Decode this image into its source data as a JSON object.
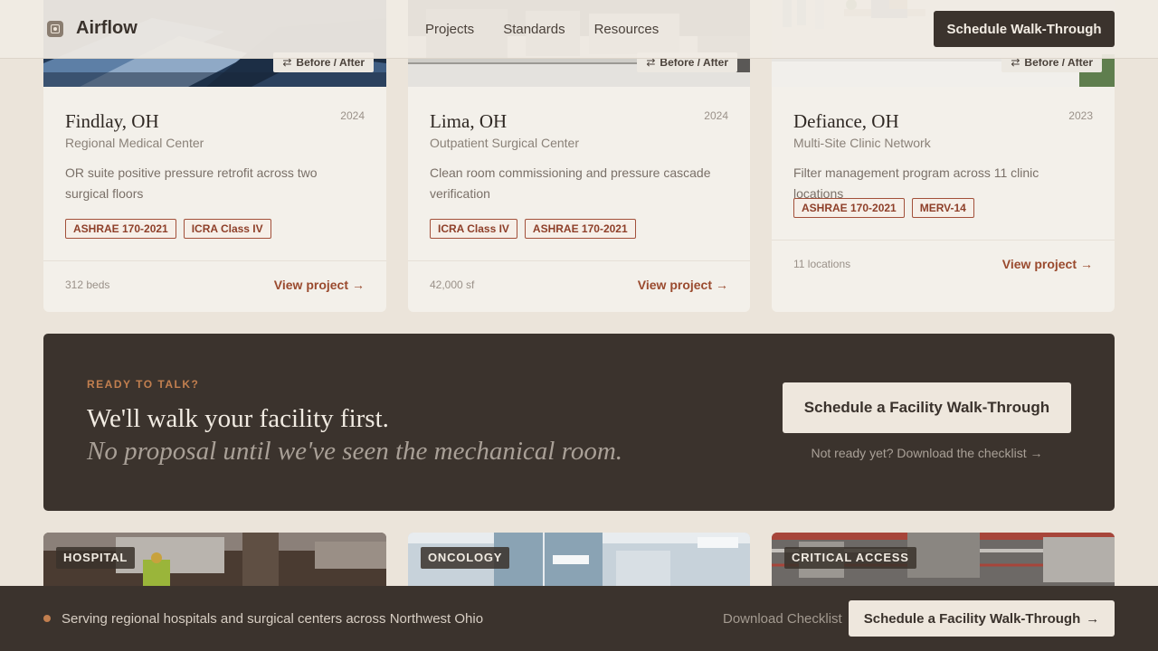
{
  "header": {
    "brand": "Airflow",
    "nav": [
      "Projects",
      "Standards",
      "Resources"
    ],
    "cta": "Schedule Walk-Through"
  },
  "projects": [
    {
      "badge": "Before / After",
      "year": "2024",
      "city": "Findlay, OH",
      "type": "Regional Medical Center",
      "description": "OR suite positive pressure retrofit across two surgical floors",
      "tags": [
        "ASHRAE 170-2021",
        "ICRA Class IV"
      ],
      "stat": "312 beds",
      "link": "View project"
    },
    {
      "badge": "Before / After",
      "year": "2024",
      "city": "Lima, OH",
      "type": "Outpatient Surgical Center",
      "description": "Clean room commissioning and pressure cascade verification",
      "tags": [
        "ICRA Class IV",
        "ASHRAE 170-2021"
      ],
      "stat": "42,000 sf",
      "link": "View project"
    },
    {
      "badge": "Before / After",
      "year": "2023",
      "city": "Defiance, OH",
      "type": "Multi-Site Clinic Network",
      "description": "Filter management program across 11 clinic locations",
      "tags": [
        "ASHRAE 170-2021",
        "MERV-14"
      ],
      "stat": "11 locations",
      "link": "View project"
    }
  ],
  "cta_band": {
    "eyebrow": "READY TO TALK?",
    "headline": "We'll walk your facility first.",
    "subheadline": "No proposal until we've seen the mechanical room.",
    "primary_button": "Schedule a Facility Walk-Through",
    "secondary_link": "Not ready yet? Download the checklist →"
  },
  "facilities": [
    {
      "label": "HOSPITAL"
    },
    {
      "label": "ONCOLOGY"
    },
    {
      "label": "CRITICAL ACCESS"
    }
  ],
  "sticky_bar": {
    "text": "Serving regional hospitals and surgical centers across Northwest Ohio",
    "link": "Download Checklist",
    "button": "Schedule a Facility Walk-Through"
  },
  "colors": {
    "accent": "#9a4a2e",
    "eyebrow": "#c27f4f",
    "dark": "#3b332d",
    "background": "#ebe4da"
  }
}
